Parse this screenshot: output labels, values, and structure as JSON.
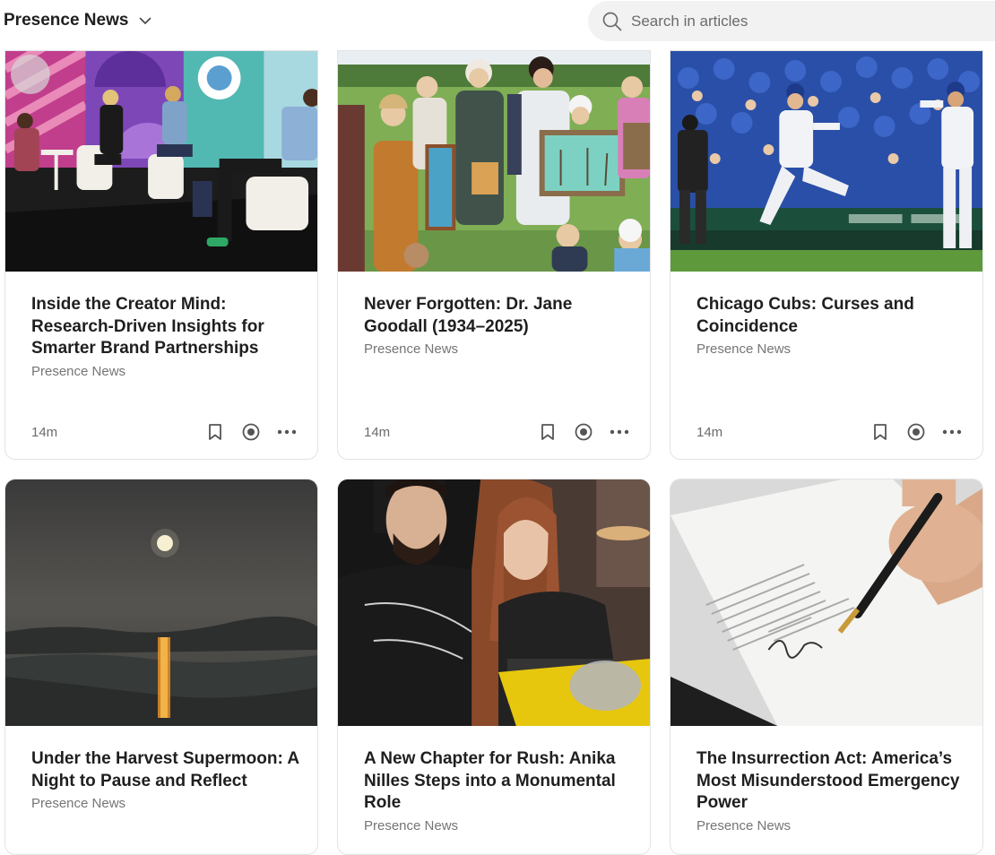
{
  "header": {
    "publication": "Presence News",
    "search_placeholder": "Search in articles"
  },
  "articles": [
    {
      "title": "Inside the Creator Mind: Research-Driven Insights for Smarter Brand Partnerships",
      "source": "Presence News",
      "read_time": "14m"
    },
    {
      "title": "Never Forgotten: Dr. Jane Goodall (1934–2025)",
      "source": "Presence News",
      "read_time": "14m"
    },
    {
      "title": "Chicago Cubs: Curses and Coincidence",
      "source": "Presence News",
      "read_time": "14m"
    },
    {
      "title": "Under the Harvest Supermoon: A Night to Pause and Reflect",
      "source": "Presence News"
    },
    {
      "title": "A New Chapter for Rush: Anika Nilles Steps into a Monumental Role",
      "source": "Presence News"
    },
    {
      "title": "The Insurrection Act: America’s Most Misunderstood Emergency Power",
      "source": "Presence News"
    }
  ],
  "icons": {
    "chevron": "chevron-down-icon",
    "search": "search-icon",
    "bookmark": "bookmark-icon",
    "listen": "listen-icon",
    "more": "more-icon"
  },
  "colors": {
    "text": "#1f1f1f",
    "muted": "#757575",
    "search_bg": "#f2f2f2",
    "card_border": "#e3e3e3"
  }
}
